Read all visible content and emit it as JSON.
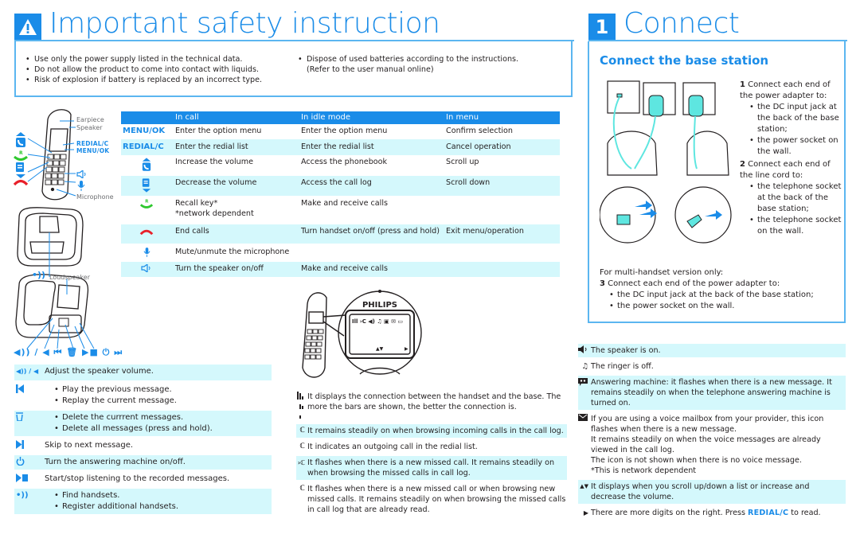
{
  "safety": {
    "title": "Important safety instruction",
    "icon": "warning-icon",
    "bullets_left": [
      "Use only the power supply listed in the technical data.",
      "Do not allow the product to come into contact with liquids.",
      "Risk of explosion if battery is replaced by an incorrect type."
    ],
    "bullets_right": [
      "Dispose of used batteries according to the instructions. (Refer to the user manual online)"
    ]
  },
  "handset_labels": {
    "earpiece": "Earpiece",
    "speaker": "Speaker",
    "redial": "REDIAL/C",
    "menu_ok": "MENU/OK",
    "microphone": "Microphone",
    "loudspeaker": "Loudspeaker",
    "base_keys": "◀)) / ◀  ⏮ 🗑 ▶■ ⏻ ⏭"
  },
  "keys_table": {
    "headers": [
      "",
      "In call",
      "In idle mode",
      "In menu"
    ],
    "rows": [
      {
        "key": "MENU/OK",
        "key_type": "text",
        "in_call": "Enter the option menu",
        "idle": "Enter the option menu",
        "menu": "Confirm selection",
        "shaded": false
      },
      {
        "key": "REDIAL/C",
        "key_type": "text",
        "in_call": "Enter the redial list",
        "idle": "Enter the redial list",
        "menu": "Cancel operation",
        "shaded": true
      },
      {
        "key": "phonebook-up-icon",
        "key_type": "icon",
        "in_call": "Increase the volume",
        "idle": "Access the phonebook",
        "menu": "Scroll up",
        "shaded": false
      },
      {
        "key": "calllog-down-icon",
        "key_type": "icon",
        "in_call": "Decrease the volume",
        "idle": "Access the call log",
        "menu": "Scroll down",
        "shaded": true
      },
      {
        "key": "talk-recall-icon",
        "key_type": "icon",
        "in_call": "Recall key*",
        "in_call_note": "*network dependent",
        "idle": "Make and receive calls",
        "menu": "",
        "shaded": false
      },
      {
        "key": "end-call-icon",
        "key_type": "icon",
        "in_call": "End calls",
        "idle": "Turn handset on/off (press and hold)",
        "menu": "Exit menu/operation",
        "shaded": true
      },
      {
        "key": "microphone-mute-icon",
        "key_type": "icon",
        "in_call": "Mute/unmute the microphone",
        "idle": "",
        "menu": "",
        "shaded": false
      },
      {
        "key": "speaker-icon",
        "key_type": "icon",
        "in_call": "Turn the speaker on/off",
        "idle": "Make and receive calls",
        "menu": "",
        "shaded": true
      }
    ]
  },
  "answering_machine": {
    "rows": [
      {
        "icon": "volume-icon",
        "icon_text": "◀)) / ◀",
        "lines": [
          "Adjust the speaker volume."
        ],
        "bulleted": false,
        "shaded": true
      },
      {
        "icon": "previous-icon",
        "icon_text": "⏮",
        "lines": [
          "Play the previous message.",
          "Replay the current message."
        ],
        "bulleted": true,
        "shaded": false
      },
      {
        "icon": "delete-icon",
        "icon_text": "🗑",
        "lines": [
          "Delete the currrent messages.",
          "Delete all messages (press and hold)."
        ],
        "bulleted": true,
        "shaded": true
      },
      {
        "icon": "next-icon",
        "icon_text": "⏭",
        "lines": [
          "Skip to next message."
        ],
        "bulleted": false,
        "shaded": false
      },
      {
        "icon": "power-icon",
        "icon_text": "⏻",
        "lines": [
          "Turn the answering machine on/off."
        ],
        "bulleted": false,
        "shaded": true
      },
      {
        "icon": "play-stop-icon",
        "icon_text": "▶■",
        "lines": [
          "Start/stop listening to the recorded messages."
        ],
        "bulleted": false,
        "shaded": false
      },
      {
        "icon": "find-handset-icon",
        "icon_text": "•))",
        "lines": [
          "Find handsets.",
          "Register additional handsets."
        ],
        "bulleted": true,
        "shaded": true
      }
    ]
  },
  "display": {
    "brand": "PHILIPS",
    "icons_middle": [
      {
        "icon": "signal-icon",
        "text": "It displays the connection between the handset and the base. The more the bars are shown, the better the connection is.",
        "shaded": false
      },
      {
        "icon": "incoming-call-icon",
        "text": "It remains steadily on when browsing incoming calls in the call log.",
        "shaded": true
      },
      {
        "icon": "outgoing-call-icon",
        "text": "It indicates an outgoing call in the redial list.",
        "shaded": false
      },
      {
        "icon": "missed-call-icon",
        "text": "It flashes when there is a new missed call. It remains steadily on when browsing the missed calls in call log.",
        "shaded": true
      },
      {
        "icon": "call-icon",
        "text": "It flashes when there is a new missed call or when browsing new missed calls. It remains steadily on when browsing the missed calls in call log that are already read.",
        "shaded": false
      }
    ],
    "icons_right": [
      {
        "icon": "speaker-on-icon",
        "text": "The speaker is on.",
        "shaded": true
      },
      {
        "icon": "ringer-off-icon",
        "text": "The ringer is off.",
        "shaded": false
      },
      {
        "icon": "answering-machine-icon",
        "text": "Answering machine: it flashes when there is a new message. It remains steadily on when the telephone answering machine is turned on.",
        "shaded": true
      },
      {
        "icon": "voicemail-icon",
        "text": "If you are using a voice mailbox from your provider, this icon flashes when there is a new message.\nIt remains steadily on when the voice messages are already viewed in the call log.\nThe icon is not shown when there is no voice message.\n*This is network dependent",
        "shaded": false
      },
      {
        "icon": "scroll-updown-icon",
        "text": "It displays when you scroll up/down a list or increase and decrease the volume.",
        "shaded": true
      },
      {
        "icon": "more-digits-icon",
        "text_pre": "There are more digits on the right. Press ",
        "text_key": "REDIAL/C",
        "text_post": " to read.",
        "shaded": false
      }
    ]
  },
  "connect": {
    "number": "1",
    "title": "Connect",
    "subtitle": "Connect the base station",
    "step1": {
      "num": "1",
      "text": "Connect each end of the power adapter to:",
      "bullets": [
        "the DC input jack at the back of the base station;",
        "the power socket on the wall."
      ]
    },
    "step2": {
      "num": "2",
      "text": "Connect each end of the line cord to:",
      "bullets": [
        "the telephone socket at the back of the base station;",
        "the telephone socket on the wall."
      ]
    },
    "multi_note": "For multi-handset version only:",
    "step3": {
      "num": "3",
      "text": "Connect each end of the power adapter to:",
      "bullets": [
        "the DC input jack at the back of the base station;",
        "the power socket on the wall."
      ]
    }
  },
  "colors": {
    "accent": "#1a8ce8",
    "row_shade": "#d4f8fc",
    "green": "#2ec82e",
    "red": "#e8202a",
    "teal": "#5ee6e0"
  }
}
